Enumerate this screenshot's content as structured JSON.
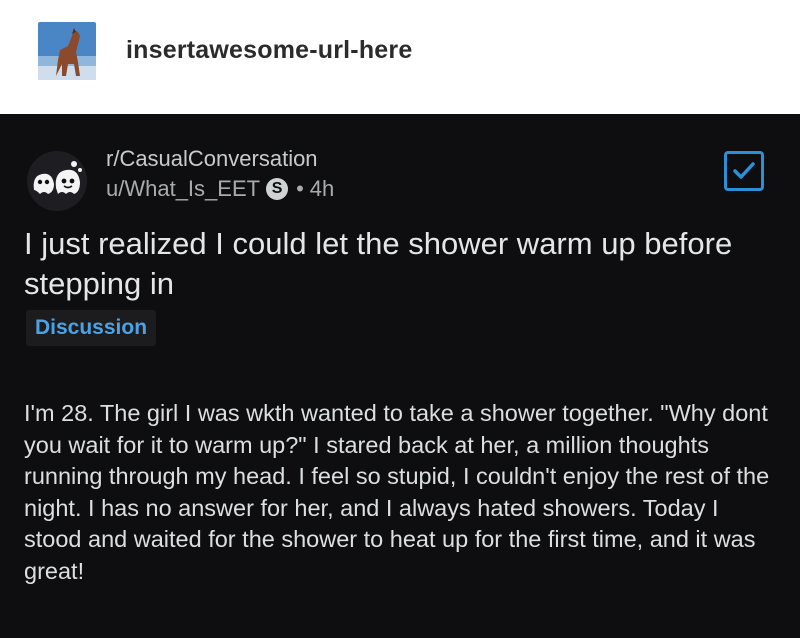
{
  "header": {
    "blog_name": "insertawesome-url-here",
    "avatar_icon": "dog-avatar-icon"
  },
  "post": {
    "subreddit": "r/CasualConversation",
    "username": "u/What_Is_EET",
    "user_flair": "S",
    "separator": "•",
    "age": "4h",
    "title": "I just realized I could let the shower warm up before stepping in",
    "flair": "Discussion",
    "body": "I'm 28. The girl I was wkth wanted to take a shower together. \"Why dont you wait for it to warm up?\"  I stared back at her, a million thoughts running through my head. I feel so stupid, I couldn't enjoy the rest of the night. I has no answer for her, and I always hated showers. Today I stood and waited for the shower to heat up for the first time, and it was great!"
  },
  "icons": {
    "subreddit": "ghost-snoo-icon",
    "check": "checkmark-icon"
  },
  "colors": {
    "card_background": "#0e0e10",
    "accent_blue": "#2d8fd5",
    "flair_text": "#4aa3e6"
  }
}
